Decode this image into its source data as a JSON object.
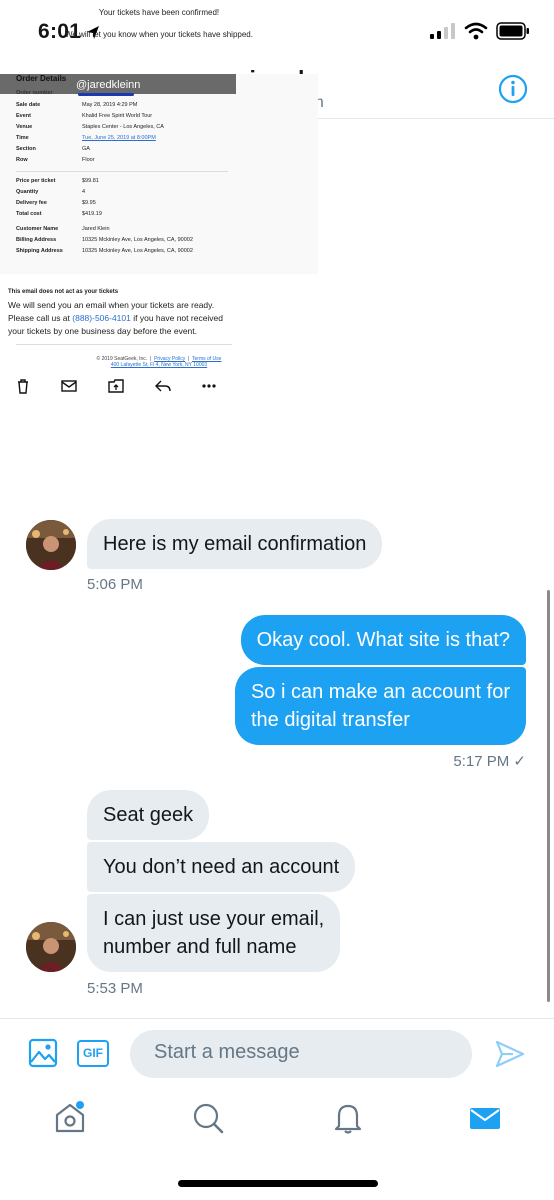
{
  "status": {
    "time": "6:01"
  },
  "header": {
    "name": "jared",
    "handle": "@jaredkleinn"
  },
  "email": {
    "confirm_line": "Your tickets have been confirmed!",
    "ship_line": "We will let you know when your tickets have shipped.",
    "order_title": "Order Details",
    "overlay_handle": "@jaredkleinn",
    "order_number_label": "Order number",
    "rows": [
      {
        "k": "Sale date",
        "v": "May 28, 2019 4:29 PM"
      },
      {
        "k": "Event",
        "v": "Khalid Free Spirit World Tour"
      },
      {
        "k": "Venue",
        "v": "Staples Center - Los Angeles, CA"
      },
      {
        "k": "Time",
        "v": "Tue, June 25, 2019 at 8:00PM"
      },
      {
        "k": "Section",
        "v": "GA"
      },
      {
        "k": "Row",
        "v": "Floor"
      }
    ],
    "price_rows": [
      {
        "k": "Price per ticket",
        "v": "$99.81"
      },
      {
        "k": "Quantity",
        "v": "4"
      },
      {
        "k": "Delivery fee",
        "v": "$9.95"
      },
      {
        "k": "Total cost",
        "v": "$419.19"
      }
    ],
    "customer_rows": [
      {
        "k": "Customer Name",
        "v": "Jared Klein"
      },
      {
        "k": "Billing Address",
        "v": "10325 Mckinley Ave, Los Angeles, CA, 90002"
      },
      {
        "k": "Shipping Address",
        "v": "10325 Mckinley Ave, Los Angeles, CA, 90002"
      }
    ],
    "notice_title": "This email does not act as your tickets",
    "notice_l1": "We will send you an email when your tickets are ready.",
    "notice_l2a": "Please call us at ",
    "notice_phone": "(888)-506-4101",
    "notice_l2b": " if you have not received",
    "notice_l3": "your tickets by one business day before the event.",
    "footer_copy": "© 2019 SeatGeek, Inc.",
    "footer_sep": "|",
    "footer_privacy": "Privacy Policy",
    "footer_terms": "Terms of Use",
    "footer_address": "400 Lafayette St, Fl 4, New York, NY 10003"
  },
  "messages": {
    "m1": "Here is my email confirmation",
    "t1": "5:06 PM",
    "m2": "Okay cool. What site is that?",
    "m3_l1": "So i can make an account for",
    "m3_l2": "the digital transfer",
    "t2": "5:17 PM",
    "t2_check": "✓",
    "m4": "Seat geek",
    "m5": "You don’t need an account",
    "m6_l1": "I can just use your email,",
    "m6_l2": "number and full name",
    "t3": "5:53 PM"
  },
  "composer": {
    "placeholder": "Start a message",
    "gif_label": "GIF"
  },
  "colors": {
    "accent": "#1da1f2",
    "incoming": "#e6ecf0",
    "muted": "#657786"
  }
}
